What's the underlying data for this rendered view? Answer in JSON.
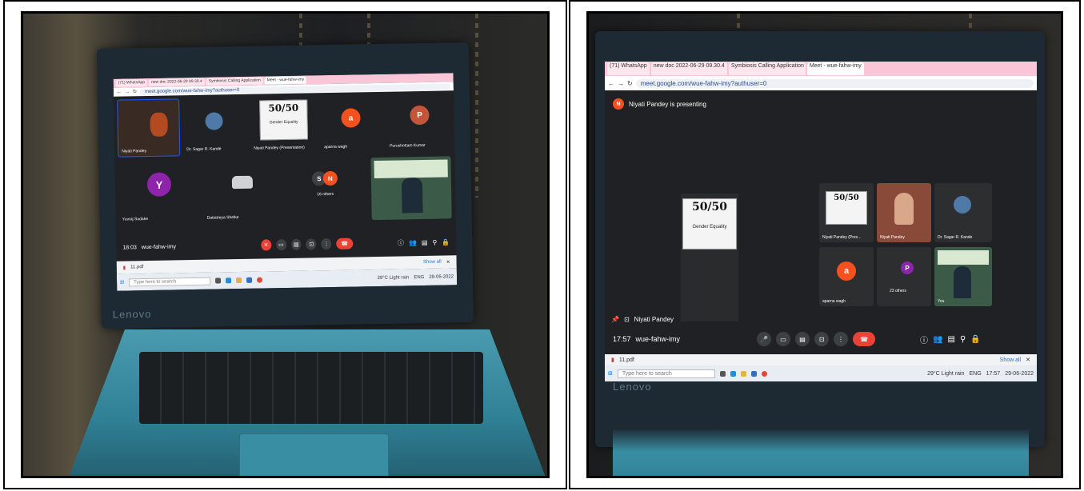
{
  "left": {
    "tabs": [
      "(71) WhatsApp",
      "new doc 2022-06-29 09.30.4",
      "Symbiosis Calling Application",
      "Meet - wue-fahw-imy"
    ],
    "url": "meet.google.com/wue-fahw-imy?authuser=0",
    "tiles": [
      {
        "name": "Niyati Pandey"
      },
      {
        "name": "Dr. Sagar R. Kande"
      },
      {
        "name": "Niyati Pandey (Presentation)"
      },
      {
        "name": "aparna wagh",
        "initial": "a"
      },
      {
        "name": "Purushottam Kumar",
        "initial": "P"
      },
      {
        "name": "Yuvraj Sudake",
        "initial": "Y"
      },
      {
        "name": "Dattatreya Shelke"
      },
      {
        "name": "18 others",
        "initials": [
          "S",
          "N"
        ]
      },
      {
        "name": ""
      }
    ],
    "slide": {
      "logo": "50/50",
      "caption": "Gender Equality"
    },
    "time": "18:03",
    "meeting_code": "wue-fahw-imy",
    "download": {
      "file": "11.pdf",
      "show_all": "Show all"
    },
    "taskbar": {
      "search": "Type here to search",
      "weather": "29°C Light rain",
      "lang": "ENG",
      "date": "29-06-2022"
    },
    "brand": "Lenovo"
  },
  "right": {
    "tabs": [
      "(71) WhatsApp",
      "new doc 2022-06-29 09.30.4",
      "Symbiosis Calling Application",
      "Meet - wue-fahw-imy"
    ],
    "url": "meet.google.com/wue-fahw-imy?authuser=0",
    "presenting": "Niyati Pandey is presenting",
    "presenter_initial": "N",
    "slide": {
      "logo": "50/50",
      "caption": "Gender Equality"
    },
    "tiles": [
      {
        "name": "Niyati Pandey (Pres..."
      },
      {
        "name": "Niyati Pandey"
      },
      {
        "name": "Dr. Sagar R. Kande"
      },
      {
        "name": "aparna wagh",
        "initial": "a"
      },
      {
        "name": "23 others",
        "initials": [
          "P"
        ]
      },
      {
        "name": "You"
      }
    ],
    "self_label": "Niyati Pandey",
    "time": "17:57",
    "meeting_code": "wue-fahw-imy",
    "download": {
      "file": "11.pdf",
      "show_all": "Show all"
    },
    "taskbar": {
      "search": "Type here to search",
      "weather": "29°C Light rain",
      "lang": "ENG",
      "time": "17:57",
      "date": "29-06-2022"
    },
    "brand": "Lenovo"
  },
  "colors": {
    "meet_bg": "#202124",
    "tile": "#3c4043",
    "accent_red": "#ea4335",
    "avatar_orange": "#f4511e",
    "avatar_purple": "#8e24aa",
    "tab_pink": "#f8c6d6",
    "laptop_teal": "#3a8ea4"
  }
}
